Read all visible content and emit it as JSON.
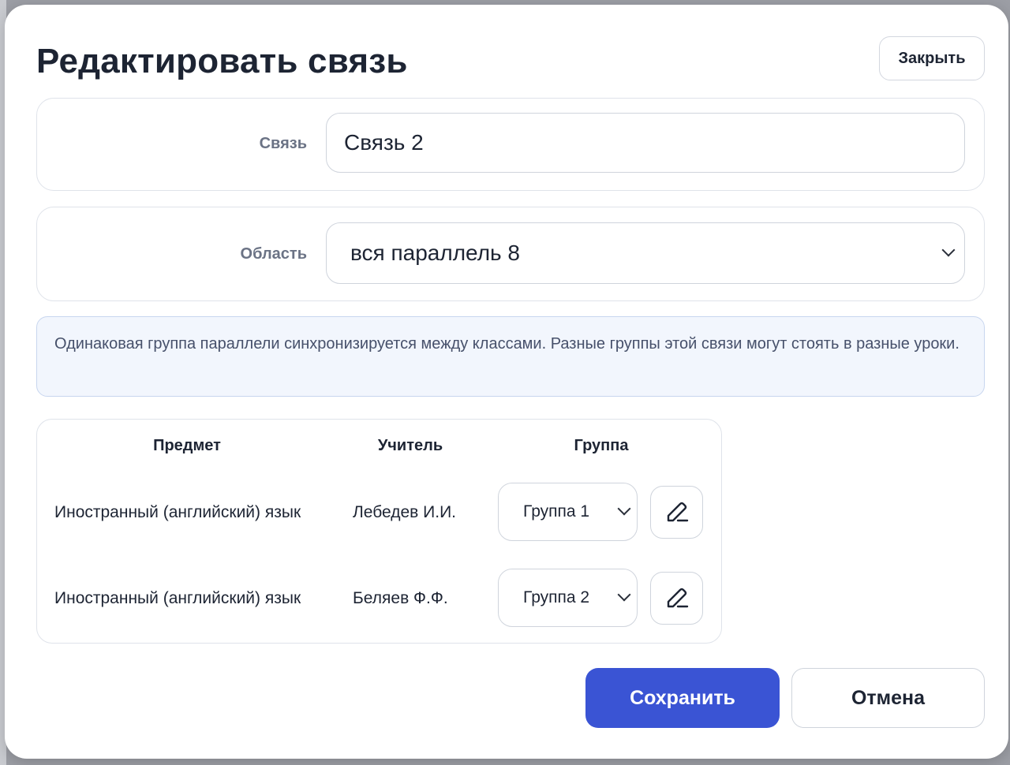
{
  "dialog": {
    "title": "Редактировать связь",
    "close_label": "Закрыть"
  },
  "form": {
    "name_label": "Связь",
    "name_value": "Связь 2",
    "area_label": "Область",
    "area_value": "вся параллель 8"
  },
  "info": {
    "text": "Одинаковая группа параллели синхронизируется между классами. Разные группы этой связи могут стоять в разные уроки."
  },
  "table": {
    "headers": {
      "subject": "Предмет",
      "teacher": "Учитель",
      "group": "Группа"
    },
    "rows": [
      {
        "subject": "Иностранный (английский) язык",
        "teacher": "Лебедев И.И.",
        "group": "Группа 1"
      },
      {
        "subject": "Иностранный (английский) язык",
        "teacher": "Беляев Ф.Ф.",
        "group": "Группа 2"
      }
    ]
  },
  "actions": {
    "save_label": "Сохранить",
    "cancel_label": "Отмена"
  },
  "colors": {
    "primary": "#3a54d4",
    "text": "#1d2433",
    "label": "#6b7385",
    "info_bg": "#f2f6fd",
    "info_border": "#c8d6ef"
  },
  "icons": {
    "edit": "pencil-icon",
    "dropdown": "chevron-down-icon"
  }
}
